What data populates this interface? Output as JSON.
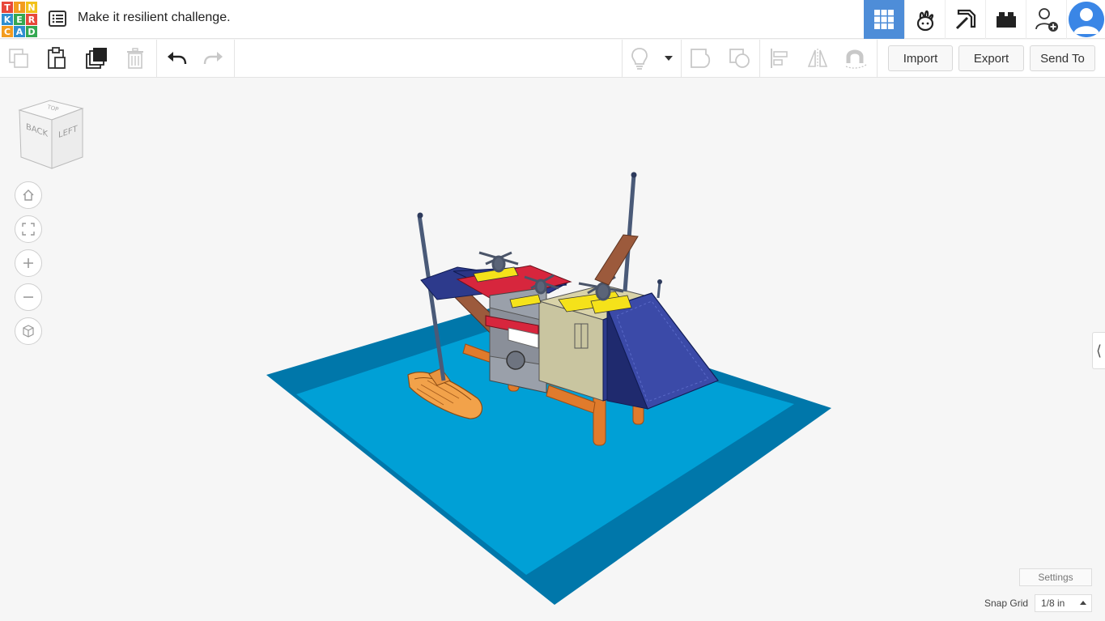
{
  "app": {
    "title": "Make it resilient challenge.",
    "logo_letters": [
      "T",
      "I",
      "N",
      "K",
      "E",
      "R",
      "C",
      "A",
      "D"
    ],
    "logo_colors": [
      "#e8483b",
      "#f39c1f",
      "#f2c21a",
      "#2f8fd1",
      "#35a852",
      "#e8483b",
      "#f39c1f",
      "#2f8fd1",
      "#35a852"
    ]
  },
  "header": {
    "icons": [
      "3d-design-grid-icon",
      "sim-lab-icon",
      "minecraft-pickaxe-icon",
      "lego-brick-icon",
      "add-user-icon",
      "avatar"
    ],
    "active_color": "#4e8dd8"
  },
  "toolbar": {
    "import_label": "Import",
    "export_label": "Export",
    "send_to_label": "Send To"
  },
  "view_cube": {
    "back_label": "BACK",
    "left_label": "LEFT"
  },
  "scene": {
    "water_color": "#00a0d6",
    "water_edge_color": "#0077aa",
    "pillar_color": "#e07b2c",
    "hull_color": "#2d3a8c",
    "deck_color": "#d7263d",
    "panel_color": "#c9c5a0",
    "helipad_color": "#f5e21a"
  },
  "bottom": {
    "settings_label": "Settings",
    "snap_grid_label": "Snap Grid",
    "snap_grid_value": "1/8 in"
  }
}
